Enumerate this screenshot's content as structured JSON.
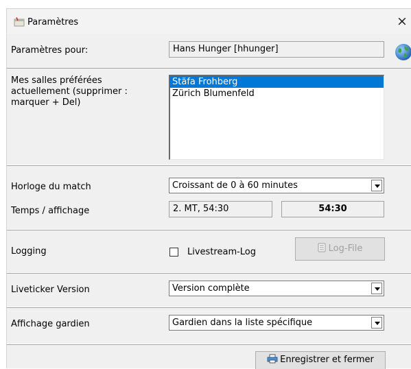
{
  "window": {
    "title": "Paramètres",
    "close_glyph": "×"
  },
  "settings_for": {
    "label": "Paramètres pour:",
    "value": "Hans Hunger [hhunger]"
  },
  "favorite_rooms": {
    "label": "Mes salles préférées actuellement (supprimer : marquer + Del)",
    "items": [
      {
        "label": "Stäfa Frohberg",
        "selected": true
      },
      {
        "label": "Zürich Blumenfeld",
        "selected": false
      }
    ]
  },
  "match_clock": {
    "label": "Horloge du match",
    "value": "Croissant de 0 à 60 minutes"
  },
  "time_display": {
    "label": "Temps / affichage",
    "value_text": "2. MT, 54:30",
    "value_time": "54:30"
  },
  "logging": {
    "label": "Logging",
    "checkbox_label": "Livestream-Log",
    "checked": false,
    "logfile_button": "Log-File"
  },
  "liveticker": {
    "label": "Liveticker Version",
    "value": "Version complète"
  },
  "goalkeeper": {
    "label": "Affichage gardien",
    "value": "Gardien dans la liste spécifique"
  },
  "footer": {
    "save_button": "Enregistrer et fermer"
  },
  "icons": {
    "app": "settings-window-icon",
    "globe": "globe-icon",
    "logfile": "document-icon",
    "save": "printer-save-icon"
  },
  "colors": {
    "selection": "#0078d7",
    "window_bg": "#f0f0f0",
    "disabled_text": "#a0a0a0"
  }
}
